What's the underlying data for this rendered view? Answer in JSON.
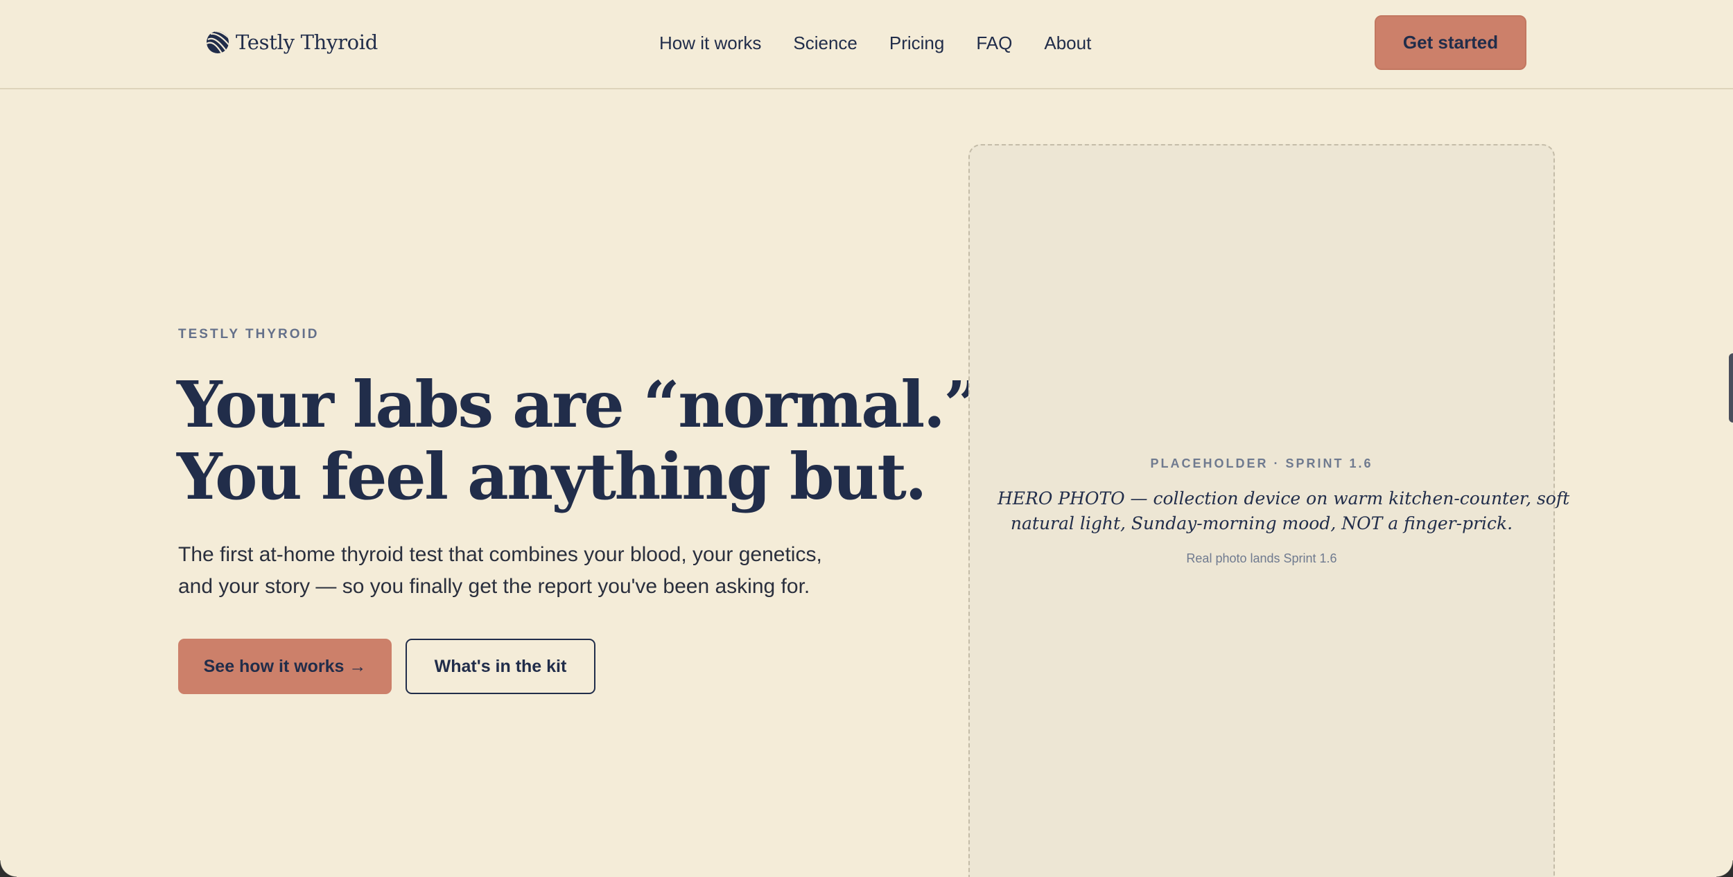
{
  "header": {
    "brand_name": "Testly Thyroid",
    "brand_icon": "striped-globe-logo-icon",
    "nav": [
      {
        "label": "How it works"
      },
      {
        "label": "Science"
      },
      {
        "label": "Pricing"
      },
      {
        "label": "FAQ"
      },
      {
        "label": "About"
      }
    ],
    "cta_label": "Get started"
  },
  "hero": {
    "eyebrow": "TESTLY THYROID",
    "headline_line1": "Your labs are “normal.”",
    "headline_line2": "You feel anything but.",
    "subtitle_line1": "The first at-home thyroid test that combines your blood, your genetics,",
    "subtitle_line2": "and your story — so you finally get the report you've been asking for.",
    "primary_button": "See how it works →",
    "secondary_button": "What's in the kit"
  },
  "placeholder": {
    "label": "PLACEHOLDER · SPRINT 1.6",
    "description_line1": "HERO PHOTO — collection device on warm kitchen-counter, soft",
    "description_line2": "natural light, Sunday-morning mood, NOT a finger-prick.",
    "note": "Real photo lands Sprint 1.6"
  },
  "colors": {
    "background": "#f4ecd8",
    "navy": "#212d4a",
    "terracotta": "#cc806a",
    "placeholder_bg": "#ede6d4",
    "muted": "#6f7a8f"
  }
}
